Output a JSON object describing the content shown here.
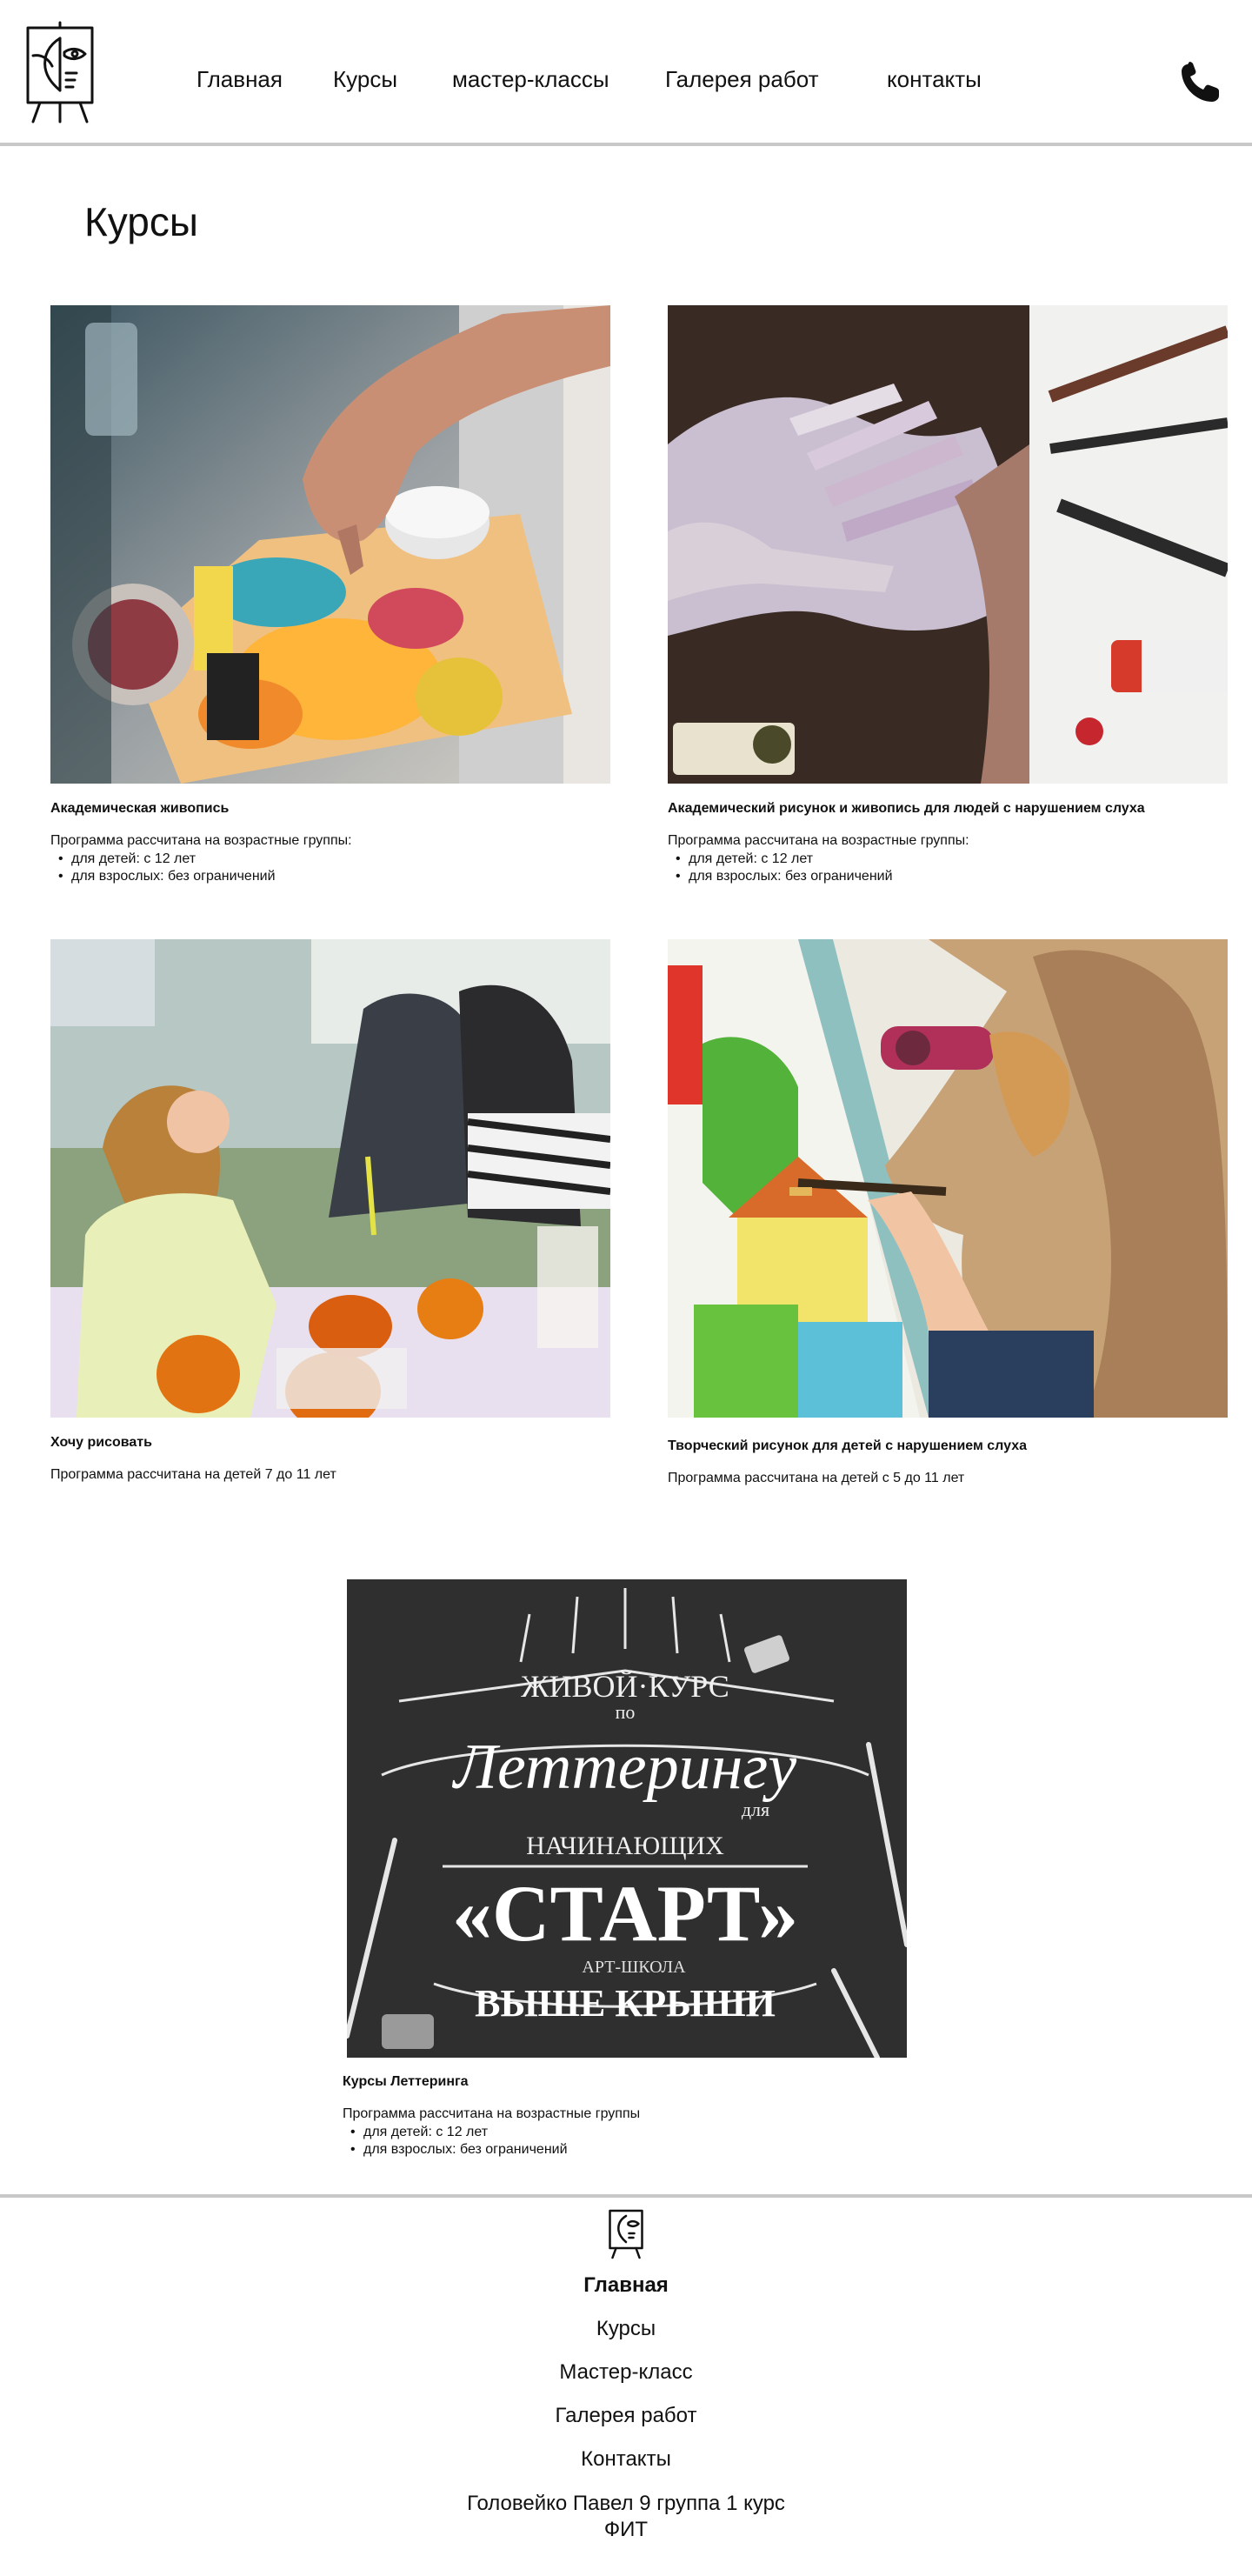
{
  "nav": {
    "items": [
      "Главная",
      "Курсы",
      "мастер-классы",
      "Галерея работ",
      "контакты"
    ],
    "phone_icon": "phone-icon",
    "logo_icon": "easel-face-logo"
  },
  "page_title": "Курсы",
  "courses": [
    {
      "title": "Академическая живопись",
      "desc": "Программа рассчитана на возрастные группы:",
      "bullets": [
        "для детей: с 12 лет",
        "для взрослых: без ограничений"
      ]
    },
    {
      "title": "Академический рисунок и живопись для людей с нарушением слуха",
      "desc": "Программа рассчитана на возрастные группы:",
      "bullets": [
        "для детей: с 12 лет",
        "для взрослых: без ограничений"
      ]
    },
    {
      "title": "Хочу рисовать",
      "desc": "Программа рассчитана на детей 7 до 11 лет",
      "bullets": []
    },
    {
      "title": "Творческий рисунок для детей с нарушением слуха",
      "desc": "Программа рассчитана на детей с 5 до 11 лет",
      "bullets": []
    },
    {
      "title": "Курсы Леттеринга",
      "desc": "Программа рассчитана на возрастные группы",
      "bullets": [
        "для детей: с 12 лет",
        "для взрослых: без ограничений"
      ],
      "image_text": [
        "ЖИВОЙ·КУРС",
        "по",
        "Леттерингу",
        "для",
        "НАЧИНАЮЩИХ",
        "«СТАРТ»",
        "АРТ-ШКОЛА",
        "ВЫШЕ КРЫШИ"
      ]
    }
  ],
  "footer": {
    "nav": [
      "Главная",
      "Курсы",
      "Мастер-класс",
      "Галерея работ",
      "Контакты"
    ],
    "credit_line1": "Головейко Павел 9 группа 1 курс",
    "credit_line2": "ФИТ"
  }
}
